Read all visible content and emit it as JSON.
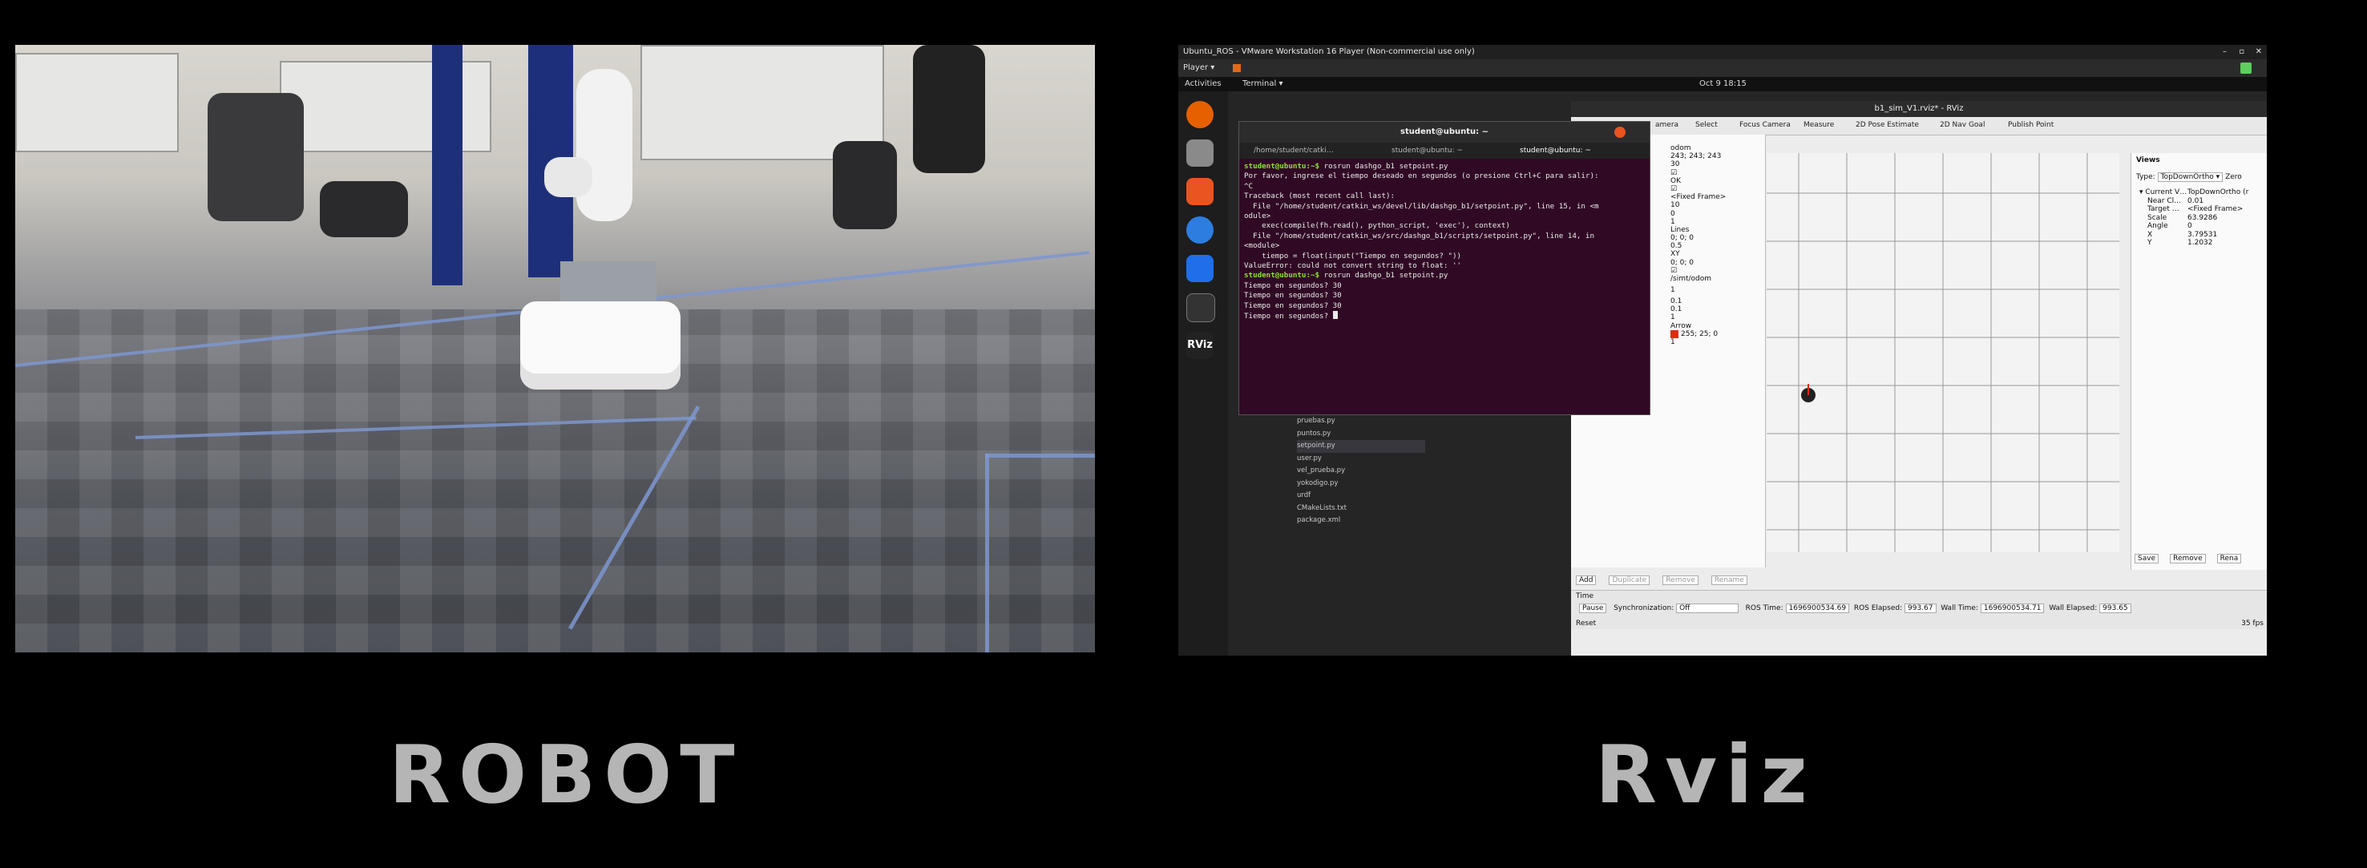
{
  "captions": {
    "left": "ROBOT",
    "right": "Rviz"
  },
  "vm": {
    "title": "Ubuntu_ROS - VMware Workstation 16 Player (Non-commercial use only)",
    "player_menu": "Player ▾",
    "window_controls": [
      "–",
      "▫",
      "✕"
    ]
  },
  "gnome": {
    "activities": "Activities",
    "app_menu": "Terminal ▾",
    "clock": "Oct 9  18:15"
  },
  "terminal": {
    "title": "student@ubuntu: ~",
    "tabs": [
      "/home/student/catki…",
      "student@ubuntu: ~",
      "student@ubuntu: ~"
    ],
    "lines": [
      {
        "prompt": "student@ubuntu:~$",
        "text": " rosrun dashgo_b1 setpoint.py"
      },
      {
        "prompt": "",
        "text": "Por favor, ingrese el tiempo deseado en segundos (o presione Ctrl+C para salir):"
      },
      {
        "prompt": "",
        "text": "^C"
      },
      {
        "prompt": "",
        "text": "Traceback (most recent call last):"
      },
      {
        "prompt": "",
        "text": "  File \"/home/student/catkin_ws/devel/lib/dashgo_b1/setpoint.py\", line 15, in <m"
      },
      {
        "prompt": "",
        "text": "odule>"
      },
      {
        "prompt": "",
        "text": "    exec(compile(fh.read(), python_script, 'exec'), context)"
      },
      {
        "prompt": "",
        "text": "  File \"/home/student/catkin_ws/src/dashgo_b1/scripts/setpoint.py\", line 14, in"
      },
      {
        "prompt": "",
        "text": "<module>"
      },
      {
        "prompt": "",
        "text": "    tiempo = float(input(\"Tiempo en segundos? \"))"
      },
      {
        "prompt": "",
        "text": "ValueError: could not convert string to float: ''"
      },
      {
        "prompt": "student@ubuntu:~$",
        "text": " rosrun dashgo_b1 setpoint.py"
      },
      {
        "prompt": "",
        "text": "Tiempo en segundos? 30"
      },
      {
        "prompt": "",
        "text": "Tiempo en segundos? 30"
      },
      {
        "prompt": "",
        "text": "Tiempo en segundos? 30"
      },
      {
        "prompt": "",
        "text": "Tiempo en segundos? "
      }
    ]
  },
  "files": [
    "pruebas.py",
    "puntos.py",
    "setpoint.py",
    "user.py",
    "vel_prueba.py",
    "yokodigo.py",
    "urdf",
    "CMakeLists.txt",
    "package.xml"
  ],
  "rviz": {
    "title": "b1_sim_V1.rviz* - RViz",
    "tools": [
      "amera",
      "Select",
      "Focus Camera",
      "Measure",
      "2D Pose Estimate",
      "2D Nav Goal",
      "Publish Point"
    ],
    "displays": [
      {
        "label": "",
        "value": "odom"
      },
      {
        "label": "",
        "value": "243; 243; 243"
      },
      {
        "label": "",
        "value": "30"
      },
      {
        "label": "",
        "value": "☑"
      },
      {
        "label": "",
        "value": "OK"
      },
      {
        "label": "",
        "value": "☑"
      },
      {
        "label": "",
        "value": "<Fixed Frame>"
      },
      {
        "label": "",
        "value": "10"
      },
      {
        "label": "",
        "value": "0"
      },
      {
        "label": "",
        "value": "1"
      },
      {
        "label": "",
        "value": "Lines"
      },
      {
        "label": "",
        "value": "0; 0; 0"
      },
      {
        "label": "",
        "value": "0.5"
      },
      {
        "label": "",
        "value": "XY"
      },
      {
        "label": "",
        "value": "0; 0; 0"
      },
      {
        "label": "",
        "value": "☑"
      },
      {
        "label": "",
        "value": "/simt/odom"
      },
      {
        "label": "",
        "value": "1"
      },
      {
        "label": "Position Tolera…",
        "value": "0.1"
      },
      {
        "label": "Angle Tolerance",
        "value": "0.1"
      },
      {
        "label": "Keep",
        "value": "1"
      },
      {
        "label": "▾ Shape",
        "value": "Arrow"
      },
      {
        "label": "Color",
        "value": "255; 25; 0"
      },
      {
        "label": "Alpha",
        "value": "1"
      }
    ],
    "display_buttons": [
      "Add",
      "Duplicate",
      "Remove",
      "Rename"
    ],
    "views": {
      "header": "Views",
      "type_label": "Type:",
      "type_value": "TopDownOrtho ▾",
      "zero": "Zero",
      "rows": [
        {
          "k": "▾ Current V…",
          "v": "TopDownOrtho (r"
        },
        {
          "k": "Near Cl…",
          "v": "0.01"
        },
        {
          "k": "Target …",
          "v": "<Fixed Frame>"
        },
        {
          "k": "Scale",
          "v": "63.9286"
        },
        {
          "k": "Angle",
          "v": "0"
        },
        {
          "k": "X",
          "v": "3.79531"
        },
        {
          "k": "Y",
          "v": "1.2032"
        }
      ],
      "buttons": [
        "Save",
        "Remove",
        "Rena"
      ]
    },
    "time": {
      "header": "Time",
      "pause": "Pause",
      "sync_label": "Synchronization:",
      "sync_value": "Off",
      "ros_time_label": "ROS Time:",
      "ros_time": "1696900534.69",
      "ros_elapsed_label": "ROS Elapsed:",
      "ros_elapsed": "993.67",
      "wall_time_label": "Wall Time:",
      "wall_time": "1696900534.71",
      "wall_elapsed_label": "Wall Elapsed:",
      "wall_elapsed": "993.65",
      "reset": "Reset",
      "fps": "35 fps"
    }
  }
}
